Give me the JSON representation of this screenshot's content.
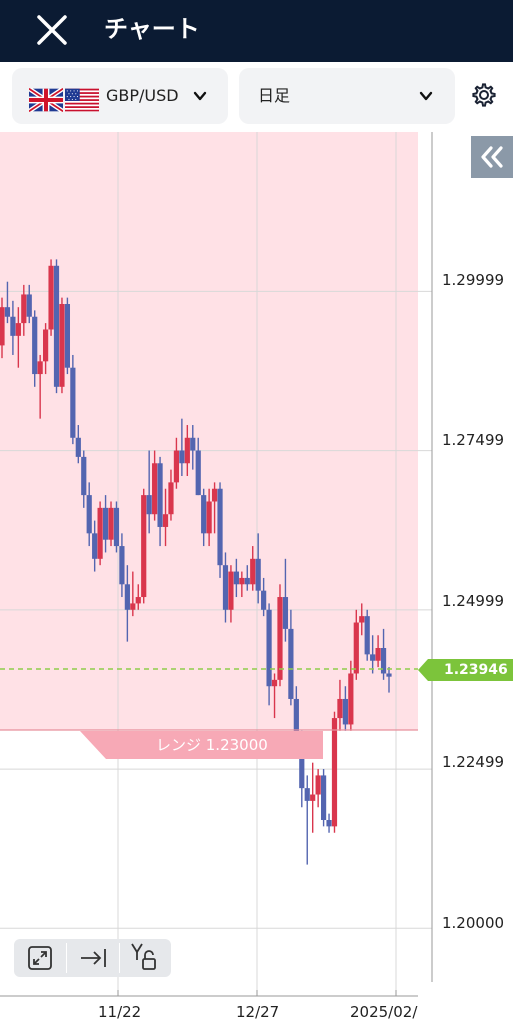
{
  "header": {
    "title": "チャート"
  },
  "toolbar": {
    "pair": "GBP/USD",
    "timeframe": "日足"
  },
  "chart_data": {
    "type": "candlestick",
    "price_labels": [
      "1.29999",
      "1.27499",
      "1.24999",
      "1.22499",
      "1.20000"
    ],
    "date_labels": [
      "11/22",
      "12/27",
      "2025/02/"
    ],
    "current_price": "1.23946",
    "range_label": "レンジ 1.23000",
    "ylim": [
      1.19,
      1.325
    ],
    "candles": [
      [
        1.2915,
        1.299,
        1.2895,
        1.2975
      ],
      [
        1.2975,
        1.3015,
        1.295,
        1.296
      ],
      [
        1.296,
        1.2985,
        1.29,
        1.293
      ],
      [
        1.293,
        1.2975,
        1.288,
        1.295
      ],
      [
        1.295,
        1.301,
        1.293,
        1.2995
      ],
      [
        1.2995,
        1.301,
        1.295,
        1.296
      ],
      [
        1.296,
        1.297,
        1.285,
        1.287
      ],
      [
        1.287,
        1.29,
        1.28,
        1.289
      ],
      [
        1.289,
        1.295,
        1.287,
        1.294
      ],
      [
        1.294,
        1.305,
        1.293,
        1.304
      ],
      [
        1.304,
        1.305,
        1.284,
        1.285
      ],
      [
        1.285,
        1.299,
        1.284,
        1.298
      ],
      [
        1.298,
        1.299,
        1.287,
        1.288
      ],
      [
        1.288,
        1.29,
        1.276,
        1.277
      ],
      [
        1.277,
        1.279,
        1.273,
        1.274
      ],
      [
        1.274,
        1.275,
        1.266,
        1.268
      ],
      [
        1.268,
        1.27,
        1.26,
        1.262
      ],
      [
        1.262,
        1.264,
        1.256,
        1.258
      ],
      [
        1.258,
        1.267,
        1.257,
        1.266
      ],
      [
        1.266,
        1.268,
        1.259,
        1.261
      ],
      [
        1.261,
        1.267,
        1.26,
        1.266
      ],
      [
        1.266,
        1.267,
        1.259,
        1.26
      ],
      [
        1.26,
        1.262,
        1.252,
        1.254
      ],
      [
        1.254,
        1.257,
        1.245,
        1.25
      ],
      [
        1.25,
        1.256,
        1.249,
        1.251
      ],
      [
        1.251,
        1.254,
        1.25,
        1.252
      ],
      [
        1.252,
        1.269,
        1.251,
        1.268
      ],
      [
        1.268,
        1.275,
        1.262,
        1.265
      ],
      [
        1.265,
        1.275,
        1.264,
        1.273
      ],
      [
        1.273,
        1.274,
        1.26,
        1.263
      ],
      [
        1.263,
        1.269,
        1.26,
        1.265
      ],
      [
        1.265,
        1.272,
        1.264,
        1.27
      ],
      [
        1.27,
        1.277,
        1.269,
        1.275
      ],
      [
        1.275,
        1.28,
        1.271,
        1.273
      ],
      [
        1.273,
        1.279,
        1.271,
        1.277
      ],
      [
        1.277,
        1.279,
        1.272,
        1.275
      ],
      [
        1.275,
        1.277,
        1.268,
        1.268
      ],
      [
        1.268,
        1.269,
        1.26,
        1.262
      ],
      [
        1.262,
        1.269,
        1.26,
        1.267
      ],
      [
        1.267,
        1.27,
        1.262,
        1.269
      ],
      [
        1.269,
        1.27,
        1.255,
        1.257
      ],
      [
        1.257,
        1.259,
        1.248,
        1.25
      ],
      [
        1.25,
        1.257,
        1.248,
        1.256
      ],
      [
        1.256,
        1.258,
        1.252,
        1.254
      ],
      [
        1.254,
        1.256,
        1.252,
        1.255
      ],
      [
        1.255,
        1.257,
        1.253,
        1.254
      ],
      [
        1.254,
        1.26,
        1.253,
        1.258
      ],
      [
        1.258,
        1.262,
        1.251,
        1.253
      ],
      [
        1.253,
        1.255,
        1.249,
        1.25
      ],
      [
        1.25,
        1.251,
        1.235,
        1.238
      ],
      [
        1.238,
        1.24,
        1.233,
        1.239
      ],
      [
        1.239,
        1.254,
        1.238,
        1.252
      ],
      [
        1.252,
        1.258,
        1.245,
        1.247
      ],
      [
        1.247,
        1.25,
        1.235,
        1.236
      ],
      [
        1.236,
        1.238,
        1.228,
        1.23
      ],
      [
        1.23,
        1.231,
        1.219,
        1.222
      ],
      [
        1.222,
        1.224,
        1.21,
        1.22
      ],
      [
        1.22,
        1.226,
        1.215,
        1.221
      ],
      [
        1.221,
        1.225,
        1.219,
        1.224
      ],
      [
        1.224,
        1.225,
        1.216,
        1.217
      ],
      [
        1.217,
        1.218,
        1.215,
        1.216
      ],
      [
        1.216,
        1.234,
        1.215,
        1.233
      ],
      [
        1.233,
        1.239,
        1.231,
        1.236
      ],
      [
        1.236,
        1.238,
        1.231,
        1.232
      ],
      [
        1.232,
        1.242,
        1.231,
        1.24
      ],
      [
        1.24,
        1.25,
        1.239,
        1.248
      ],
      [
        1.248,
        1.251,
        1.246,
        1.249
      ],
      [
        1.249,
        1.25,
        1.242,
        1.243
      ],
      [
        1.243,
        1.246,
        1.24,
        1.242
      ],
      [
        1.242,
        1.246,
        1.241,
        1.244
      ],
      [
        1.244,
        1.247,
        1.239,
        1.24
      ],
      [
        1.24,
        1.241,
        1.237,
        1.2395
      ]
    ]
  },
  "colors": {
    "header_bg": "#0b1b33",
    "bull": "#d9364d",
    "bear": "#5365b0",
    "range_fill": "#ffe1e6",
    "current_price": "#7cc43b"
  },
  "icons": {
    "close": "close-icon",
    "settings": "gear-icon",
    "collapse": "double-chevron-left-icon",
    "fullscreen": "expand-icon",
    "jump_latest": "arrow-right-bar-icon",
    "y_lock": "y-axis-lock-icon"
  }
}
